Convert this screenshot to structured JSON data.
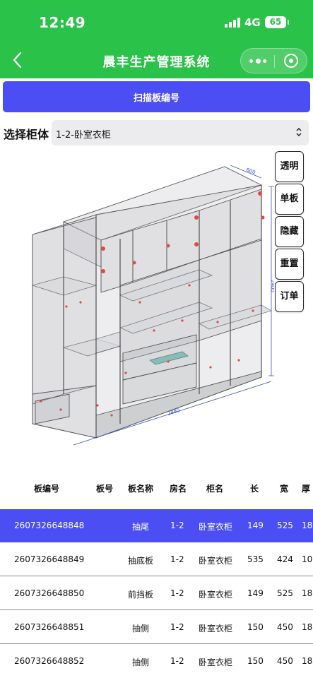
{
  "status_bar": {
    "time": "12:49",
    "network": "4G",
    "battery": "65"
  },
  "nav": {
    "title": "晨丰生产管理系统"
  },
  "scan_button": "扫描板编号",
  "cabinet_select": {
    "label": "选择柜体",
    "value": "1-2-卧室衣柜"
  },
  "side_buttons": [
    {
      "label": "透明"
    },
    {
      "label": "单板"
    },
    {
      "label": "隐藏"
    },
    {
      "label": "重置"
    },
    {
      "label": "订单"
    }
  ],
  "model_dimensions": {
    "width_label": "2880",
    "height_label": "2400",
    "depth_label": "600"
  },
  "table": {
    "headers": [
      "板编号",
      "板号",
      "板名称",
      "房名",
      "柜名",
      "长",
      "宽",
      "厚"
    ],
    "rows": [
      {
        "code": "2607326648848",
        "num": "",
        "name": "抽尾",
        "room": "1-2",
        "cabinet": "卧室衣柜",
        "length": "149",
        "width": "525",
        "thick": "18"
      },
      {
        "code": "2607326648849",
        "num": "",
        "name": "抽底板",
        "room": "1-2",
        "cabinet": "卧室衣柜",
        "length": "535",
        "width": "424",
        "thick": "10"
      },
      {
        "code": "2607326648850",
        "num": "",
        "name": "前挡板",
        "room": "1-2",
        "cabinet": "卧室衣柜",
        "length": "149",
        "width": "525",
        "thick": "18"
      },
      {
        "code": "2607326648851",
        "num": "",
        "name": "抽侧",
        "room": "1-2",
        "cabinet": "卧室衣柜",
        "length": "150",
        "width": "450",
        "thick": "18"
      },
      {
        "code": "2607326648852",
        "num": "",
        "name": "抽侧",
        "room": "1-2",
        "cabinet": "卧室衣柜",
        "length": "150",
        "width": "450",
        "thick": "18"
      }
    ],
    "selected_index": 0
  },
  "colors": {
    "nav_green": "#2bc24a",
    "accent_blue": "#4b4ef2",
    "select_bg": "#ececee"
  }
}
